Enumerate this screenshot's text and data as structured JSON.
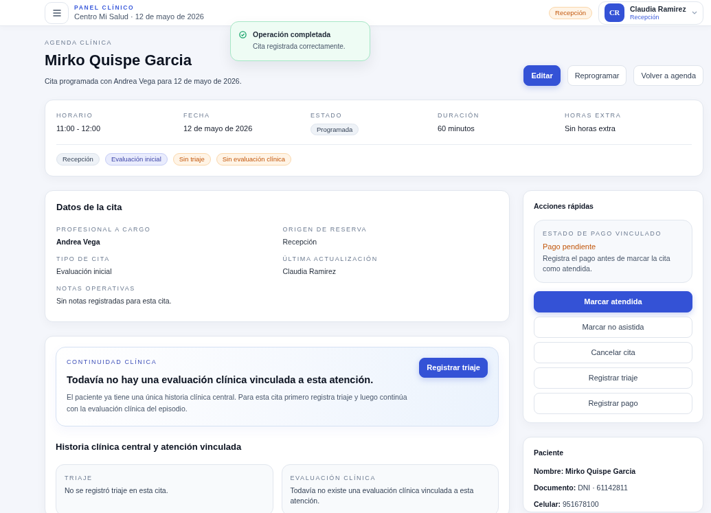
{
  "header": {
    "eyebrow": "PANEL CLÍNICO",
    "subtitle": "Centro Mi Salud · 12 de mayo de 2026",
    "role_badge": "Recepción",
    "user": {
      "initials": "CR",
      "name": "Claudia Ramirez",
      "role": "Recepción"
    }
  },
  "toast": {
    "title": "Operación completada",
    "message": "Cita registrada correctamente."
  },
  "page": {
    "eyebrow": "AGENDA CLÍNICA",
    "title": "Mirko Quispe Garcia",
    "subtitle": "Cita programada con Andrea Vega para 12 de mayo de 2026.",
    "actions": [
      {
        "label": "Editar",
        "kind": "primary"
      },
      {
        "label": "Reprogramar",
        "kind": "outline"
      },
      {
        "label": "Volver a agenda",
        "kind": "outline"
      }
    ]
  },
  "summary": {
    "fields": [
      {
        "label": "HORARIO",
        "value": "11:00 - 12:00",
        "kind": "text"
      },
      {
        "label": "FECHA",
        "value": "12 de mayo de 2026",
        "kind": "text"
      },
      {
        "label": "ESTADO",
        "value": "Programada",
        "kind": "badge"
      },
      {
        "label": "DURACIÓN",
        "value": "60 minutos",
        "kind": "text"
      },
      {
        "label": "HORAS EXTRA",
        "value": "Sin horas extra",
        "kind": "text"
      }
    ],
    "tags": [
      {
        "label": "Recepción",
        "kind": "neutral"
      },
      {
        "label": "Evaluación inicial",
        "kind": "info"
      },
      {
        "label": "Sin triaje",
        "kind": "warning"
      },
      {
        "label": "Sin evaluación clínica",
        "kind": "warning"
      }
    ]
  },
  "appointment": {
    "title": "Datos de la cita",
    "fields": [
      {
        "label": "PROFESIONAL A CARGO",
        "value": "Andrea Vega",
        "kind": "strong"
      },
      {
        "label": "ORIGEN DE RESERVA",
        "value": "Recepción",
        "kind": "text"
      },
      {
        "label": "TIPO DE CITA",
        "value": "Evaluación inicial",
        "kind": "text"
      },
      {
        "label": "ÚLTIMA ACTUALIZACIÓN",
        "value": "Claudia Ramirez",
        "kind": "text"
      },
      {
        "label": "NOTAS OPERATIVAS",
        "value": "Sin notas registradas para esta cita.",
        "kind": "text"
      }
    ]
  },
  "continuity": {
    "eyebrow": "CONTINUIDAD CLÍNICA",
    "title": "Todavía no hay una evaluación clínica vinculada a esta atención.",
    "text": "El paciente ya tiene una única historia clínica central. Para esta cita primero registra triaje y luego continúa con la evaluación clínica del episodio.",
    "action": {
      "label": "Registrar triaje",
      "kind": "primary"
    }
  },
  "history": {
    "title": "Historia clínica central y atención vinculada",
    "panels": [
      {
        "label": "TRIAJE",
        "text": "No se registró triaje en esta cita."
      },
      {
        "label": "EVALUACIÓN CLÍNICA",
        "text": "Todavía no existe una evaluación clínica vinculada a esta atención."
      }
    ]
  },
  "quick_actions": {
    "title": "Acciones rápidas",
    "payment": {
      "label": "ESTADO DE PAGO VINCULADO",
      "status": "Pago pendiente",
      "note": "Registra el pago antes de marcar la cita como atendida."
    },
    "buttons": [
      {
        "label": "Marcar atendida",
        "kind": "primary"
      },
      {
        "label": "Marcar no asistida",
        "kind": "outline"
      },
      {
        "label": "Cancelar cita",
        "kind": "outline"
      },
      {
        "label": "Registrar triaje",
        "kind": "outline"
      },
      {
        "label": "Registrar pago",
        "kind": "outline"
      }
    ]
  },
  "patient": {
    "title": "Paciente",
    "lines": [
      {
        "label": "Nombre:",
        "value": "Mirko Quispe Garcia",
        "kind": "strong"
      },
      {
        "label": "Documento:",
        "value": "DNI · 61142811",
        "kind": "plain"
      },
      {
        "label": "Celular:",
        "value": "951678100",
        "kind": "plain"
      }
    ]
  }
}
